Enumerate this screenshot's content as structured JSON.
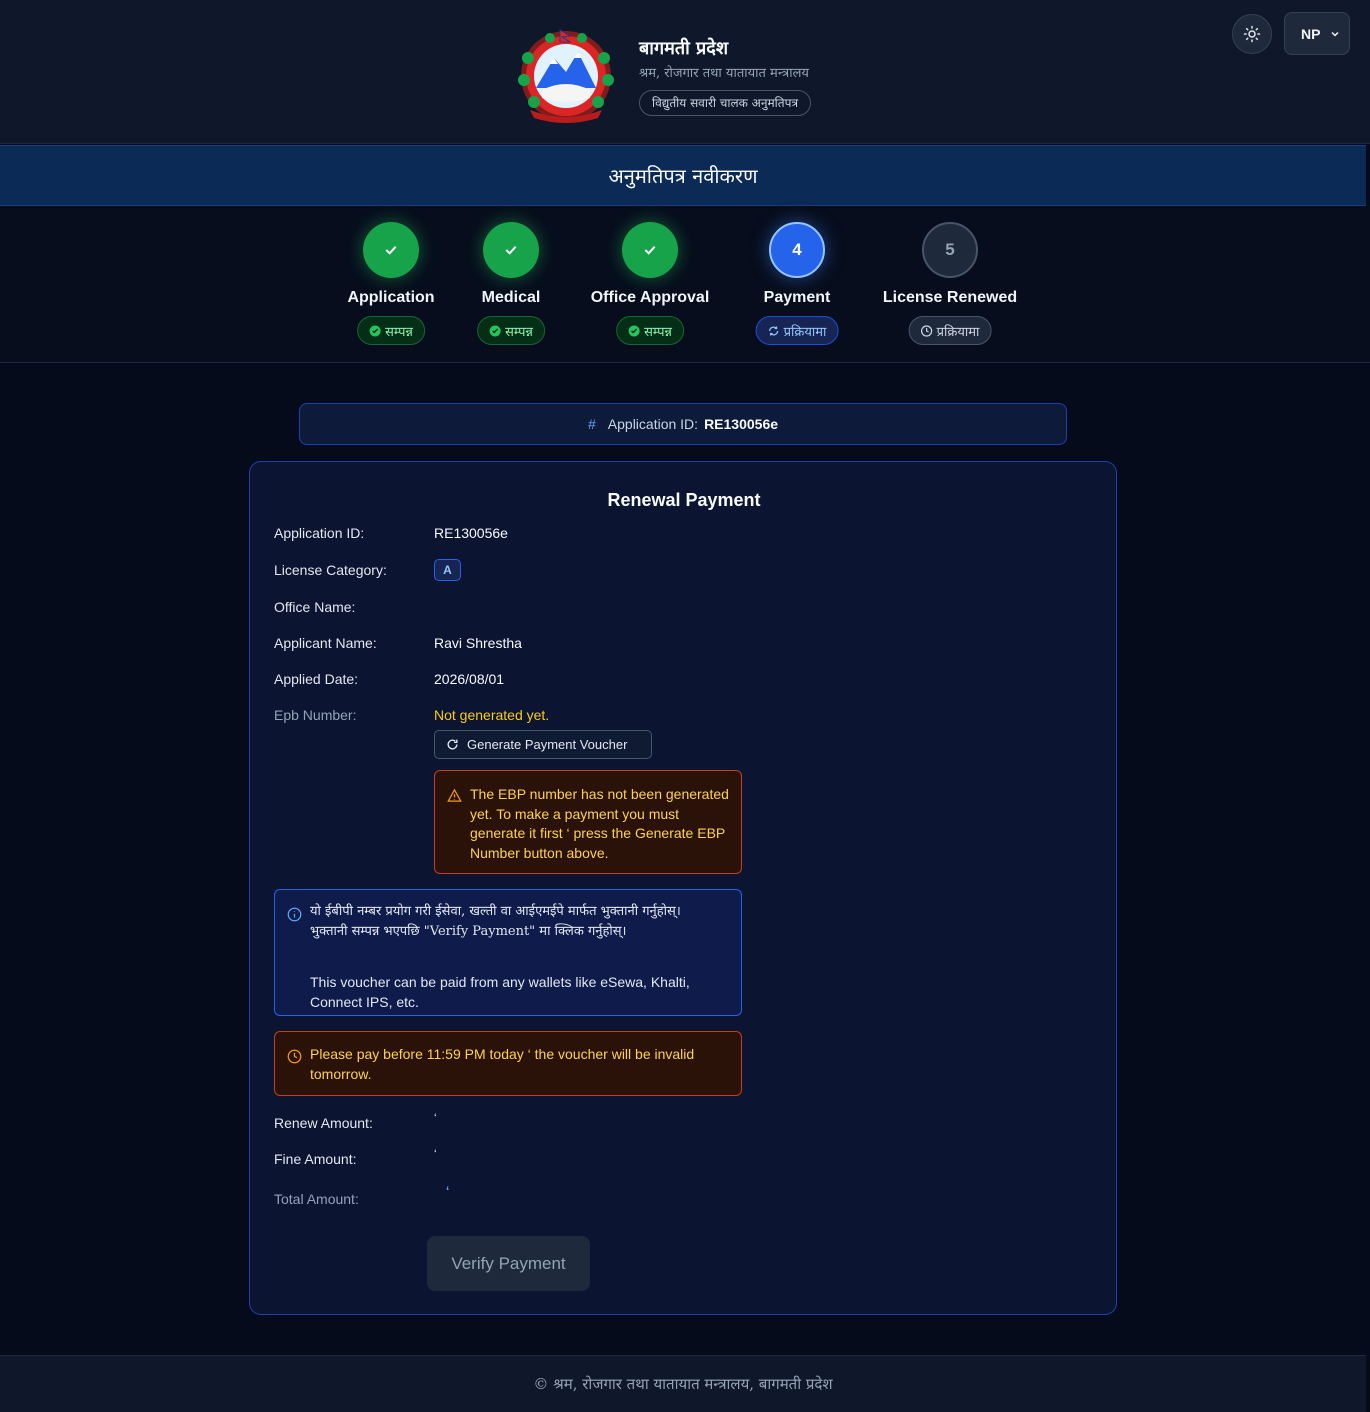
{
  "header": {
    "province": "बागमती प्रदेश",
    "ministry": "श्रम, रोजगार तथा यातायात मन्त्रालय",
    "service": "विद्युतीय सवारी चालक अनुमतिपत्र",
    "language": "NP"
  },
  "banner": {
    "title": "अनुमतिपत्र नवीकरण"
  },
  "steps": [
    {
      "label": "Application",
      "status": "सम्पन्न",
      "state": "done"
    },
    {
      "label": "Medical",
      "status": "सम्पन्न",
      "state": "done"
    },
    {
      "label": "Office Approval",
      "status": "सम्पन्न",
      "state": "done"
    },
    {
      "label": "Payment",
      "status": "प्रक्रियामा",
      "state": "active",
      "number": "4"
    },
    {
      "label": "License Renewed",
      "status": "प्रक्रियामा",
      "state": "pending",
      "number": "5"
    }
  ],
  "appid_bar": {
    "label": "Application ID:",
    "value": "RE130056e"
  },
  "card": {
    "title": "Renewal Payment",
    "fields": {
      "application_id_label": "Application ID:",
      "application_id": "RE130056e",
      "category_label": "License Category:",
      "category": "A",
      "office_label": "Office Name:",
      "office": "",
      "applicant_label": "Applicant Name:",
      "applicant": "Ravi Shrestha",
      "applied_date_label": "Applied Date:",
      "applied_date": "2026/08/01",
      "epb_label": "Epb Number:",
      "epb": "Not generated yet."
    },
    "generate_button": "Generate Payment Voucher",
    "warning": "The EBP number has not been generated yet. To make a payment you must generate it first ‘ press the Generate EBP Number button above.",
    "info_np": "यो ईबीपी नम्बर प्रयोग गरी ईसेवा, खल्ती वा आईएमईपे मार्फत भुक्तानी गर्नुहोस्। भुक्तानी सम्पन्न भएपछि \"Verify Payment\" मा क्लिक गर्नुहोस्।",
    "info_en": "This voucher can be paid from any wallets like eSewa, Khalti, Connect IPS, etc.",
    "deadline": "Please pay before 11:59 PM today ‘ the voucher will be invalid tomorrow.",
    "renew_label": "Renew Amount:",
    "renew_amount": "‘",
    "fine_label": "Fine Amount:",
    "fine_amount": "‘",
    "total_label": "Total Amount:",
    "total_amount": "‘",
    "verify_button": "Verify Payment"
  },
  "footer": {
    "text": "© श्रम, रोजगार तथा यातायात मन्त्रालय, बागमती प्रदेश"
  },
  "colors": {
    "accent": "#2563eb",
    "success": "#16a34a",
    "warning": "#facc15",
    "background": "#050b1a"
  }
}
